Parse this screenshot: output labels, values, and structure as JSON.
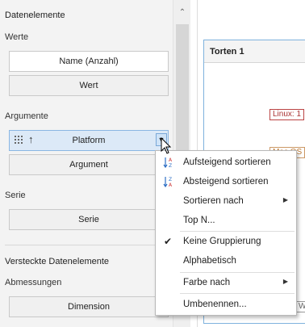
{
  "panel": {
    "title": "Datenelemente",
    "values_label": "Werte",
    "value_fields": [
      "Name (Anzahl)",
      "Wert"
    ],
    "arguments_label": "Argumente",
    "argument_selected": "Platform",
    "argument_placeholder": "Argument",
    "series_label": "Serie",
    "series_placeholder": "Serie",
    "hidden_label": "Versteckte Datenelemente",
    "dimensions_label": "Abmessungen",
    "dimension_placeholder": "Dimension"
  },
  "card": {
    "title": "Torten 1",
    "labels": [
      "Linux: 1",
      "Mac OS",
      "Wi"
    ]
  },
  "context_menu": {
    "items": [
      {
        "label": "Aufsteigend sortieren",
        "icon": "sort-ascending-icon"
      },
      {
        "label": "Absteigend sortieren",
        "icon": "sort-descending-icon"
      },
      {
        "label": "Sortieren nach",
        "submenu": true
      },
      {
        "label": "Top N..."
      },
      {
        "label": "Keine Gruppierung",
        "checked": true
      },
      {
        "label": "Alphabetisch"
      },
      {
        "label": "Farbe nach",
        "submenu": true
      },
      {
        "label": "Umbenennen..."
      }
    ]
  },
  "colors": {
    "selection_fill": "#dce9f7",
    "selection_border": "#8ab6e3",
    "card_border": "#7fb2dd",
    "linux_label": "#a33333",
    "mac_label": "#bb7733"
  }
}
